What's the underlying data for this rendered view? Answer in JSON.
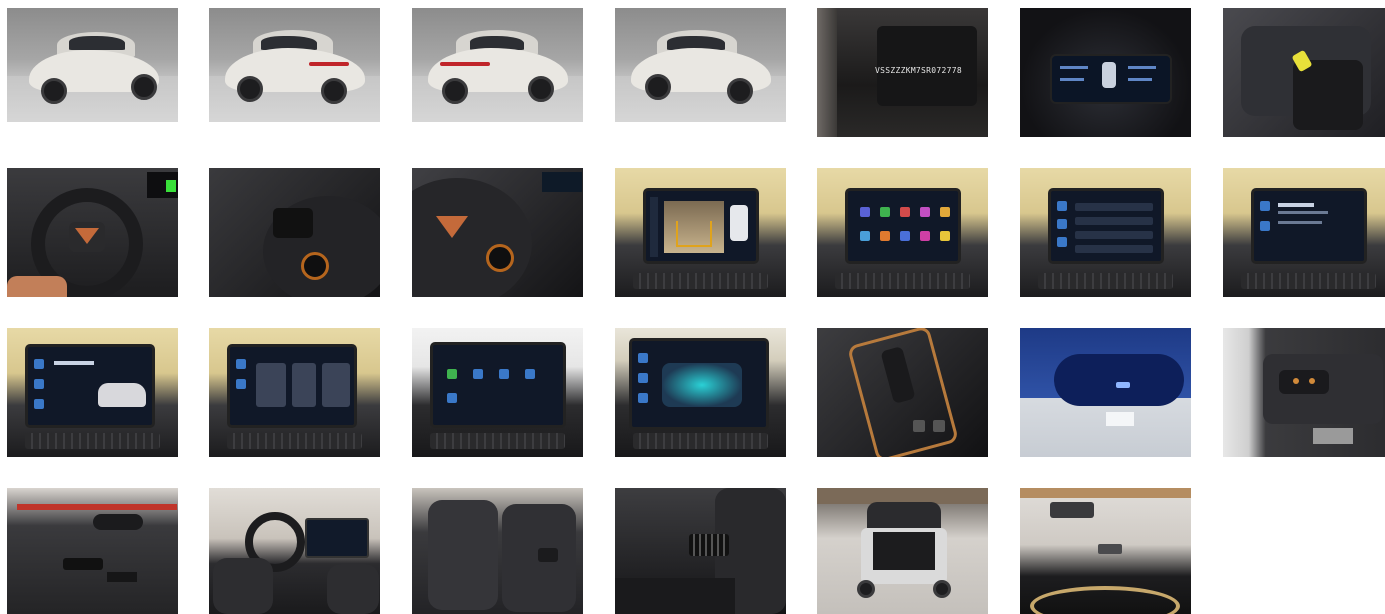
{
  "gallery": {
    "photos": [
      {
        "name": "photo-exterior-front-left",
        "icon": "car-icon"
      },
      {
        "name": "photo-exterior-rear-left",
        "icon": "car-icon"
      },
      {
        "name": "photo-exterior-rear-right",
        "icon": "car-icon"
      },
      {
        "name": "photo-exterior-front-right",
        "icon": "car-icon"
      },
      {
        "name": "photo-vin-plate",
        "icon": "vin-icon",
        "text": "VSSZZZKM7SR072778"
      },
      {
        "name": "photo-digital-cockpit",
        "icon": "gauge-icon"
      },
      {
        "name": "photo-key-on-seat",
        "icon": "key-icon"
      },
      {
        "name": "photo-steering-wheel",
        "icon": "steering-icon"
      },
      {
        "name": "photo-steering-left-controls",
        "icon": "steering-icon"
      },
      {
        "name": "photo-steering-right-controls",
        "icon": "steering-icon"
      },
      {
        "name": "photo-rear-camera-screen",
        "icon": "camera-icon"
      },
      {
        "name": "photo-infotainment-apps",
        "icon": "screen-icon"
      },
      {
        "name": "photo-infotainment-settings",
        "icon": "screen-icon"
      },
      {
        "name": "photo-infotainment-phone",
        "icon": "screen-icon"
      },
      {
        "name": "photo-infotainment-vehicle",
        "icon": "screen-icon"
      },
      {
        "name": "photo-infotainment-assist",
        "icon": "screen-icon"
      },
      {
        "name": "photo-infotainment-menu",
        "icon": "screen-icon"
      },
      {
        "name": "photo-infotainment-ambient",
        "icon": "screen-icon"
      },
      {
        "name": "photo-gear-selector",
        "icon": "gear-icon"
      },
      {
        "name": "photo-rear-view-mirror",
        "icon": "mirror-icon"
      },
      {
        "name": "photo-light-switch",
        "icon": "switch-icon"
      },
      {
        "name": "photo-door-panel",
        "icon": "door-icon"
      },
      {
        "name": "photo-front-cabin",
        "icon": "seat-icon"
      },
      {
        "name": "photo-rear-seats",
        "icon": "seat-icon"
      },
      {
        "name": "photo-rear-vents",
        "icon": "vent-icon"
      },
      {
        "name": "photo-trunk-open",
        "icon": "trunk-icon"
      },
      {
        "name": "photo-tailgate-detail",
        "icon": "trunk-icon"
      }
    ]
  }
}
